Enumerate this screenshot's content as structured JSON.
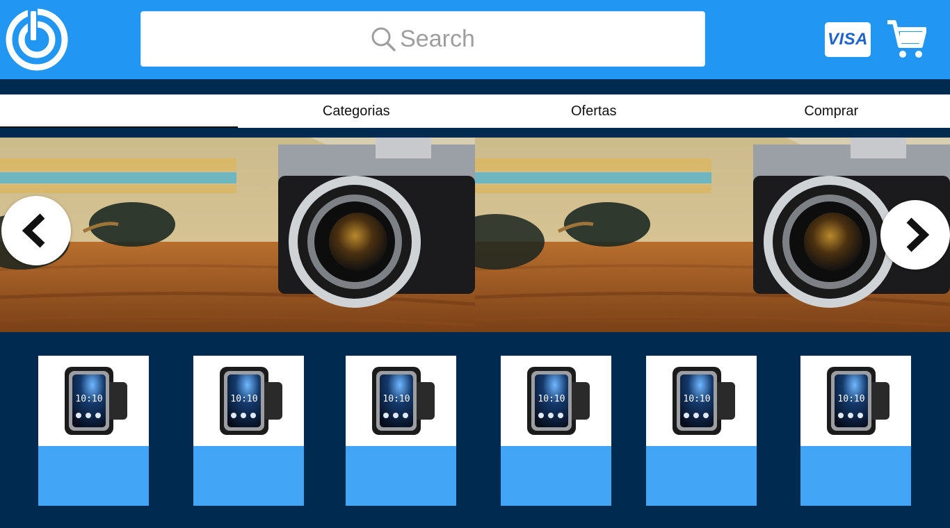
{
  "header": {
    "search_placeholder": "Search",
    "payment_badge": "VISA",
    "icons": [
      "power-logo-icon",
      "search-icon",
      "visa-card-icon",
      "shopping-cart-icon"
    ]
  },
  "nav": {
    "tabs": [
      {
        "label": ""
      },
      {
        "label": "Categorias"
      },
      {
        "label": "Ofertas"
      },
      {
        "label": "Comprar"
      }
    ]
  },
  "banner": {
    "slides": [
      "camera-photo",
      "camera-photo"
    ],
    "icons": [
      "chevron-left-icon",
      "chevron-right-icon"
    ]
  },
  "products": [
    {
      "image": "smartwatch",
      "time": "10:10"
    },
    {
      "image": "smartwatch",
      "time": "10:10"
    },
    {
      "image": "smartwatch",
      "time": "10:10"
    },
    {
      "image": "smartwatch",
      "time": "10:10"
    },
    {
      "image": "smartwatch",
      "time": "10:10"
    },
    {
      "image": "smartwatch",
      "time": "10:10"
    }
  ],
  "colors": {
    "header": "#2196f3",
    "background": "#002a4f",
    "card_bottom": "#42a5f5"
  }
}
